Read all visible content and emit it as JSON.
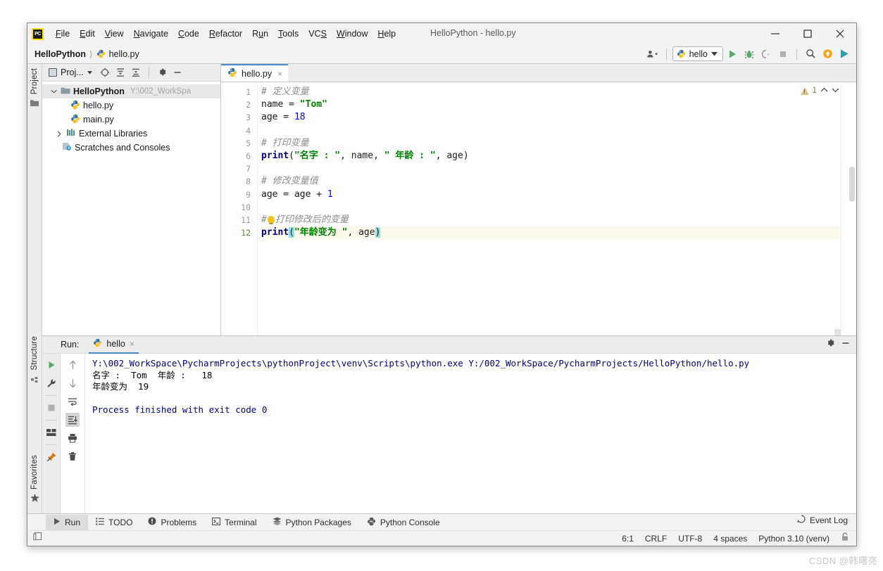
{
  "window": {
    "title": "HelloPython - hello.py",
    "logo": "pycharm-logo",
    "controls": {
      "minimize": "minimize-icon",
      "maximize": "maximize-icon",
      "close": "close-icon"
    }
  },
  "menubar": {
    "items": [
      {
        "label": "File",
        "mnemonic": "F"
      },
      {
        "label": "Edit",
        "mnemonic": "E"
      },
      {
        "label": "View",
        "mnemonic": "V"
      },
      {
        "label": "Navigate",
        "mnemonic": "N"
      },
      {
        "label": "Code",
        "mnemonic": "C"
      },
      {
        "label": "Refactor",
        "mnemonic": "R"
      },
      {
        "label": "Run",
        "mnemonic": "u"
      },
      {
        "label": "Tools",
        "mnemonic": "T"
      },
      {
        "label": "VCS",
        "mnemonic": "S"
      },
      {
        "label": "Window",
        "mnemonic": "W"
      },
      {
        "label": "Help",
        "mnemonic": "H"
      }
    ]
  },
  "navbar": {
    "breadcrumb": [
      "HelloPython",
      "hello.py"
    ],
    "separator": "〉",
    "run_config": "hello",
    "icons": [
      "user-settings-icon",
      "run-icon",
      "debug-icon",
      "run-coverage-icon",
      "stop-icon",
      "search-everywhere-icon",
      "update-project-icon",
      "launch-icon"
    ]
  },
  "left_strip": {
    "top_label": "Project",
    "bottom_labels": [
      "Structure",
      "Favorites"
    ]
  },
  "project_panel": {
    "title": "Proj...",
    "toolbar_icons": [
      "locate-icon",
      "collapse-all-icon",
      "expand-icon",
      "settings-icon",
      "hide-icon"
    ],
    "tree": [
      {
        "label": "HelloPython",
        "path": "Y:\\002_WorkSpa",
        "arrow": "⌄",
        "icon": "folder-icon",
        "bold": true,
        "indent": 0,
        "selected": true
      },
      {
        "label": "hello.py",
        "path": "",
        "arrow": "",
        "icon": "python-file-icon",
        "bold": false,
        "indent": 1,
        "selected": false
      },
      {
        "label": "main.py",
        "path": "",
        "arrow": "",
        "icon": "python-file-icon",
        "bold": false,
        "indent": 1,
        "selected": false
      },
      {
        "label": "External Libraries",
        "path": "",
        "arrow": "›",
        "icon": "library-icon",
        "bold": false,
        "indent": 0,
        "selected": false
      },
      {
        "label": "Scratches and Consoles",
        "path": "",
        "arrow": "",
        "icon": "scratches-icon",
        "bold": false,
        "indent": 0,
        "selected": false
      }
    ]
  },
  "editor": {
    "tab": {
      "label": "hello.py",
      "icon": "python-file-icon",
      "close": "×"
    },
    "inspection": {
      "warning_count": "1",
      "up": "⌃",
      "down": "⌄"
    },
    "line_numbers": [
      "1",
      "2",
      "3",
      "4",
      "5",
      "6",
      "7",
      "8",
      "9",
      "10",
      "11",
      "12"
    ],
    "code_lines": [
      "# 定义变量",
      "name = \"Tom\"",
      "age = 18",
      "",
      "# 打印变量",
      "print(\"名字 : \", name, \" 年龄 : \", age)",
      "",
      "# 修改变量值",
      "age = age + 1",
      "",
      "#打印修改后的变量",
      "print(\"年龄变为 \", age)"
    ],
    "tokens": {
      "comment1": "# 定义变量",
      "name_var": "name = ",
      "tom": "\"Tom\"",
      "age_assign": "age = ",
      "eighteen": "18",
      "comment2": "# 打印变量",
      "print_kw": "print",
      "l6_a": "(",
      "l6_s1": "\"名字 : \"",
      "l6_b": ", name, ",
      "l6_s2": "\" 年龄 : \"",
      "l6_c": ", age)",
      "comment3": "# 修改变量值",
      "l9": "age = age + ",
      "one": "1",
      "comment4a": "#",
      "comment4b": "打印修改后的变量",
      "l12_open": "(",
      "l12_str": "\"年龄变为 \"",
      "l12_mid": ", age",
      "l12_close": ")"
    }
  },
  "run_panel": {
    "label": "Run:",
    "tab": {
      "label": "hello",
      "icon": "python-icon",
      "close": "×"
    },
    "head_icons": [
      "settings-gear-icon",
      "hide-panel-icon"
    ],
    "gutter_icons": [
      "rerun-icon",
      "wrench-icon",
      "stop-icon",
      "layout-icon",
      "pin-icon"
    ],
    "gutter2_icons": [
      "up-arrow-icon",
      "down-arrow-icon",
      "soft-wrap-icon",
      "scroll-to-end-icon",
      "print-icon",
      "trash-icon"
    ],
    "console": [
      {
        "text": "Y:\\002_WorkSpace\\PycharmProjects\\pythonProject\\venv\\Scripts\\python.exe Y:/002_WorkSpace/PycharmProjects/HelloPython/hello.py",
        "kind": "command"
      },
      {
        "text": "名字 :  Tom  年龄 :   18",
        "kind": "stdout"
      },
      {
        "text": "年龄变为  19",
        "kind": "stdout"
      },
      {
        "text": "",
        "kind": "stdout"
      },
      {
        "text": "Process finished with exit code 0",
        "kind": "command"
      }
    ]
  },
  "status_bar": {
    "tools": [
      {
        "label": "Run",
        "icon": "run-icon",
        "active": true
      },
      {
        "label": "TODO",
        "icon": "todo-icon",
        "active": false
      },
      {
        "label": "Problems",
        "icon": "problems-icon",
        "active": false
      },
      {
        "label": "Terminal",
        "icon": "terminal-icon",
        "active": false
      },
      {
        "label": "Python Packages",
        "icon": "packages-icon",
        "active": false
      },
      {
        "label": "Python Console",
        "icon": "python-console-icon",
        "active": false
      }
    ],
    "event_log": {
      "label": "Event Log",
      "icon": "event-log-icon"
    },
    "right": {
      "caret": "6:1",
      "line_sep": "CRLF",
      "encoding": "UTF-8",
      "indent": "4 spaces",
      "interpreter": "Python 3.10 (venv)",
      "lock": "lock-icon"
    }
  },
  "watermark": "CSDN @韩曙亮",
  "colors": {
    "accent_blue": "#4a88c7",
    "run_green": "#51a351",
    "console_blue": "#000080",
    "string_green": "#008000",
    "keyword_navy": "#000080",
    "comment_gray": "#8c8c8c",
    "bracket_match": "#93e0e3",
    "current_line": "#fcfaed"
  }
}
